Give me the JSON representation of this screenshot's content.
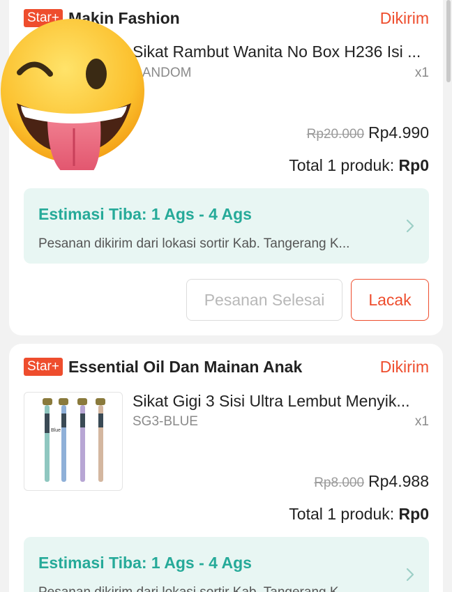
{
  "orders": [
    {
      "badge": "Star+",
      "shop_name": "Makin Fashion",
      "status": "Dikirim",
      "product_name": "Sikat Rambut Wanita No Box H236 Isi ...",
      "variant": "RANDOM",
      "qty": "x1",
      "price_old": "Rp20.000",
      "price_new": "Rp4.990",
      "total_label": "Total 1 produk:",
      "total_value": "Rp0",
      "estimate_title": "Estimasi Tiba: 1 Ags - 4 Ags",
      "estimate_sub": "Pesanan dikirim dari lokasi sortir Kab. Tangerang  K...",
      "btn_done": "Pesanan Selesai",
      "btn_track": "Lacak"
    },
    {
      "badge": "Star+",
      "shop_name": "Essential Oil Dan Mainan Anak",
      "status": "Dikirim",
      "product_name": "Sikat Gigi 3 Sisi Ultra Lembut Menyik...",
      "variant": "SG3-BLUE",
      "qty": "x1",
      "price_old": "Rp8.000",
      "price_new": "Rp4.988",
      "total_label": "Total 1 produk:",
      "total_value": "Rp0",
      "estimate_title": "Estimasi Tiba: 1 Ags - 4 Ags",
      "estimate_sub": "Pesanan dikirim dari lokasi sortir Kab. Tangerang  K"
    }
  ],
  "thumb2_label": "Blue",
  "colors": {
    "accent": "#ee4d2d",
    "teal": "#26aa99",
    "estimate_bg": "#e8f6f3"
  },
  "icons": [
    "winking-tongue-emoji-icon",
    "chevron-right-icon"
  ]
}
